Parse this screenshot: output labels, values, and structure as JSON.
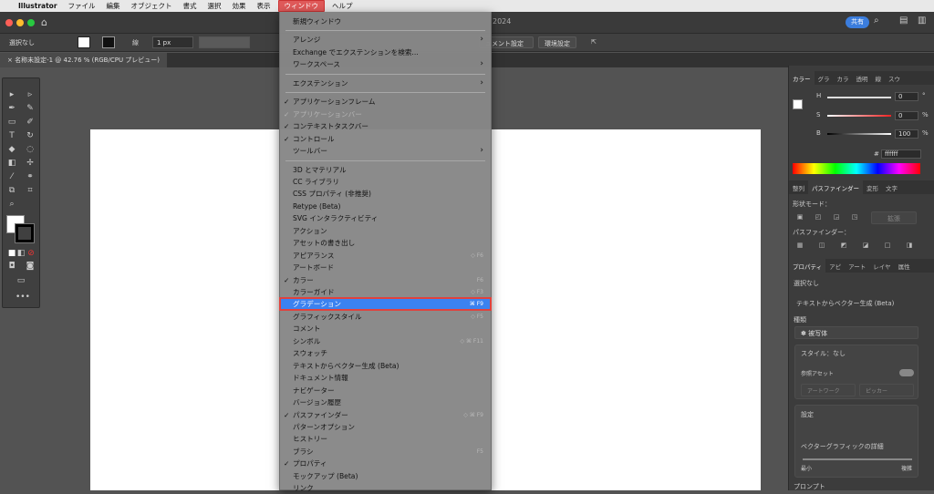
{
  "menubar": {
    "app": "Illustrator",
    "items": [
      "ファイル",
      "編集",
      "オブジェクト",
      "書式",
      "選択",
      "効果",
      "表示",
      "ウィンドウ",
      "ヘルプ"
    ],
    "active": "ウィンドウ"
  },
  "appbar": {
    "title_suffix": "2024",
    "share": "共有"
  },
  "control": {
    "selection": "選択なし",
    "stroke_weight": "1 px",
    "doc_setup": "ュメント設定",
    "prefs": "環境設定"
  },
  "doc_tab": {
    "label": "名称未設定-1 @ 42.76 % (RGB/CPU プレビュー)"
  },
  "window_menu": {
    "items": [
      {
        "label": "新規ウィンドウ"
      },
      {
        "sep": true
      },
      {
        "label": "アレンジ",
        "arrow": true
      },
      {
        "label": "Exchange でエクステンションを検索..."
      },
      {
        "label": "ワークスペース",
        "arrow": true
      },
      {
        "sep": true
      },
      {
        "label": "エクステンション",
        "arrow": true
      },
      {
        "sep": true
      },
      {
        "label": "アプリケーションフレーム",
        "check": true
      },
      {
        "label": "アプリケーションバー",
        "check": true,
        "disabled": true
      },
      {
        "label": "コンテキストタスクバー",
        "check": true
      },
      {
        "label": "コントロール",
        "check": true
      },
      {
        "label": "ツールバー",
        "arrow": true
      },
      {
        "sep": true
      },
      {
        "label": "3D とマテリアル"
      },
      {
        "label": "CC ライブラリ"
      },
      {
        "label": "CSS プロパティ (非推奨)"
      },
      {
        "label": "Retype (Beta)"
      },
      {
        "label": "SVG インタラクティビティ"
      },
      {
        "label": "アクション"
      },
      {
        "label": "アセットの書き出し"
      },
      {
        "label": "アピアランス",
        "shortcut": "◇ F6"
      },
      {
        "label": "アートボード"
      },
      {
        "label": "カラー",
        "check": true,
        "shortcut": "F6"
      },
      {
        "label": "カラーガイド",
        "shortcut": "◇ F3"
      },
      {
        "label": "グラデーション",
        "shortcut": "⌘ F9",
        "highlight": true
      },
      {
        "label": "グラフィックスタイル",
        "shortcut": "◇ F5"
      },
      {
        "label": "コメント"
      },
      {
        "label": "シンボル",
        "shortcut": "◇ ⌘ F11"
      },
      {
        "label": "スウォッチ"
      },
      {
        "label": "テキストからベクター生成 (Beta)"
      },
      {
        "label": "ドキュメント情報"
      },
      {
        "label": "ナビゲーター"
      },
      {
        "label": "バージョン履歴"
      },
      {
        "label": "パスファインダー",
        "check": true,
        "shortcut": "◇ ⌘ F9"
      },
      {
        "label": "パターンオプション"
      },
      {
        "label": "ヒストリー"
      },
      {
        "label": "ブラシ",
        "shortcut": "F5"
      },
      {
        "label": "プロパティ",
        "check": true
      },
      {
        "label": "モックアップ (Beta)"
      },
      {
        "label": "リンク"
      }
    ]
  },
  "color_panel": {
    "tabs": [
      "カラー",
      "グラ",
      "カラ",
      "透明",
      "線",
      "スウ"
    ],
    "h_label": "H",
    "h_value": "0",
    "h_unit": "°",
    "s_label": "S",
    "s_value": "0",
    "s_unit": "%",
    "b_label": "B",
    "b_value": "100",
    "b_unit": "%",
    "hex": "ffffff"
  },
  "pathfinder_panel": {
    "tabs": [
      "整列",
      "パスファインダー",
      "変形",
      "文字"
    ],
    "shape_modes": "形状モード：",
    "expand": "拡張",
    "pathfinders": "パスファインダー："
  },
  "properties_panel": {
    "tabs": [
      "プロパティ",
      "アピ",
      "アート",
      "レイヤ",
      "属性"
    ],
    "selection": "選択なし",
    "text_to_vector": "テキストからベクター生成 (Beta)",
    "kind_label": "種類",
    "kind_value": "被写体",
    "style": "スタイル：なし",
    "ref_asset": "参照アセット",
    "artwork": "アートワーク",
    "picker": "ピッカー",
    "settings": "設定",
    "detail": "ベクターグラフィックの詳細",
    "min": "最小",
    "max": "複雑",
    "prompt": "プロンプト"
  }
}
